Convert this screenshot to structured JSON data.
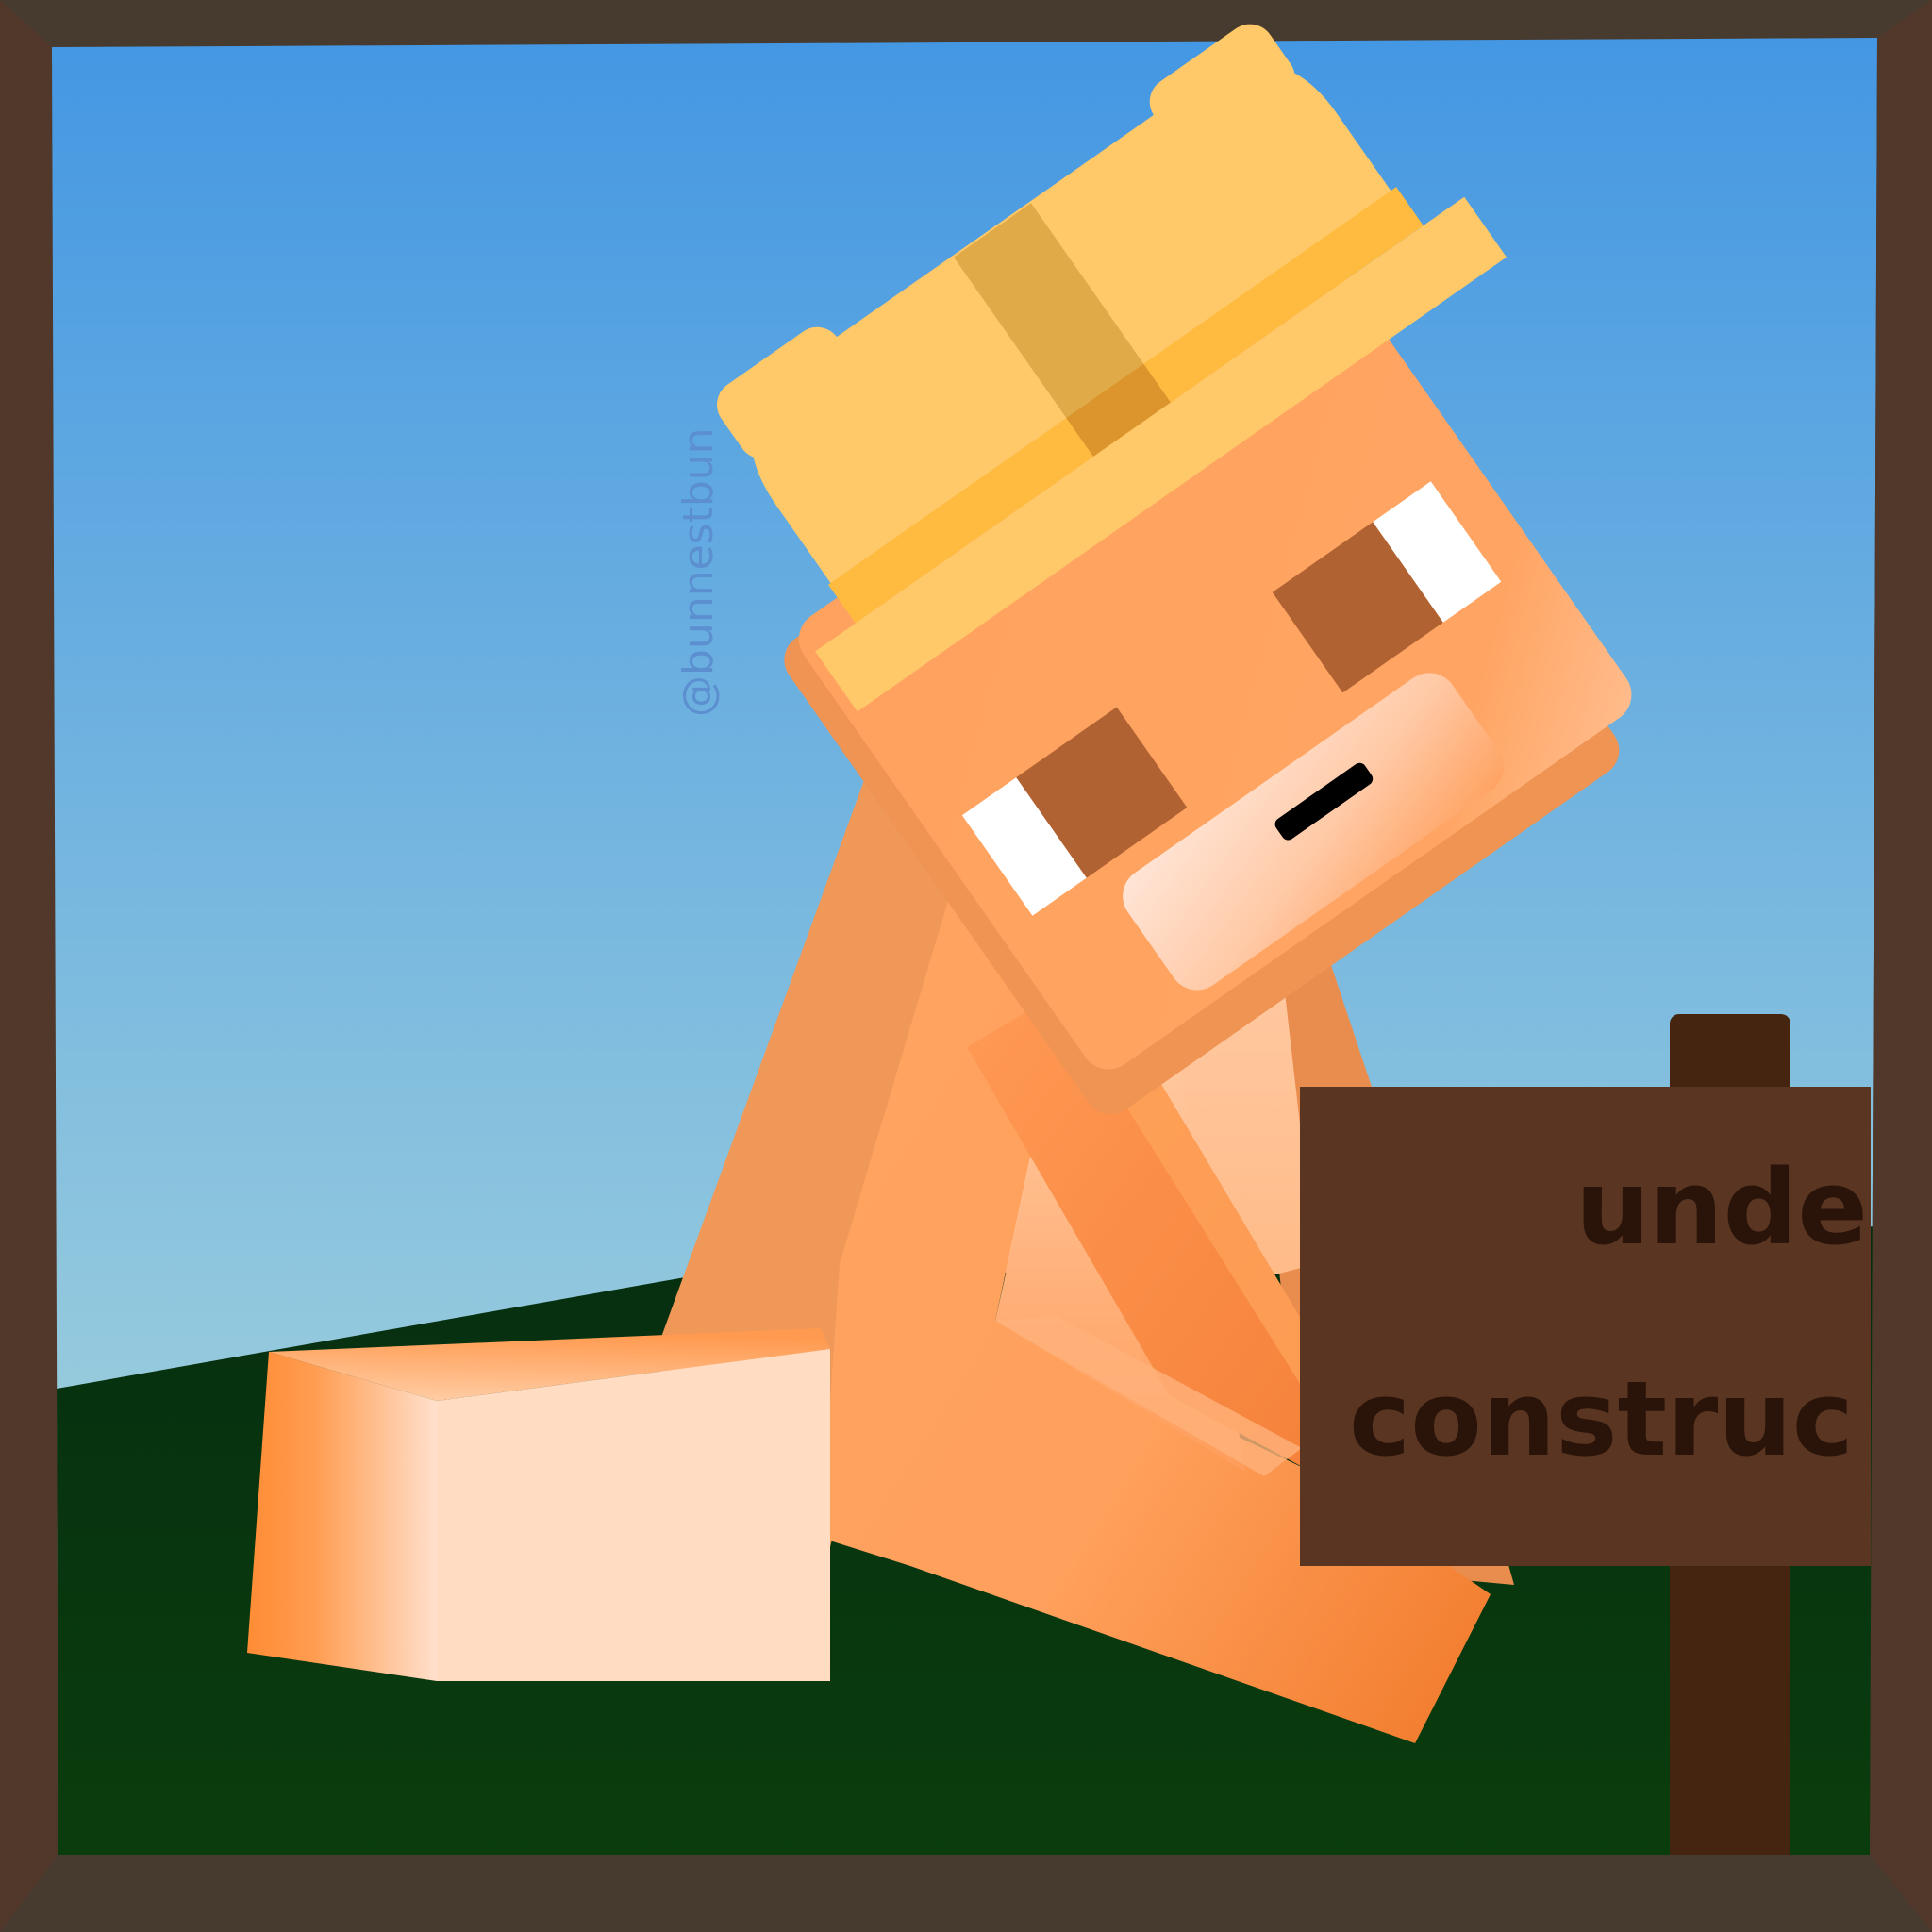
{
  "illustration": {
    "sign": {
      "line_1": "under",
      "line_2": "construc"
    },
    "watermark": "@bunnestbun"
  },
  "colors": {
    "frame_top": "#473a2f",
    "frame_side": "#52382a",
    "sky_top": "#4497e3",
    "sky_bottom": "#b0dcdc",
    "grass_top": "#062e10",
    "grass_bottom": "#0a3d0d",
    "skin_main": "#ffa25f",
    "skin_shadow": "#ef9858",
    "skin_light": "#ffdcc2",
    "hat_main": "#ffc868",
    "hat_band": "#ffbb40",
    "hat_strip": "#e0aa48",
    "eye_brown": "#b06232",
    "sign_board": "#5a3622",
    "sign_post": "#45250f",
    "sign_text": "#2a140a"
  }
}
